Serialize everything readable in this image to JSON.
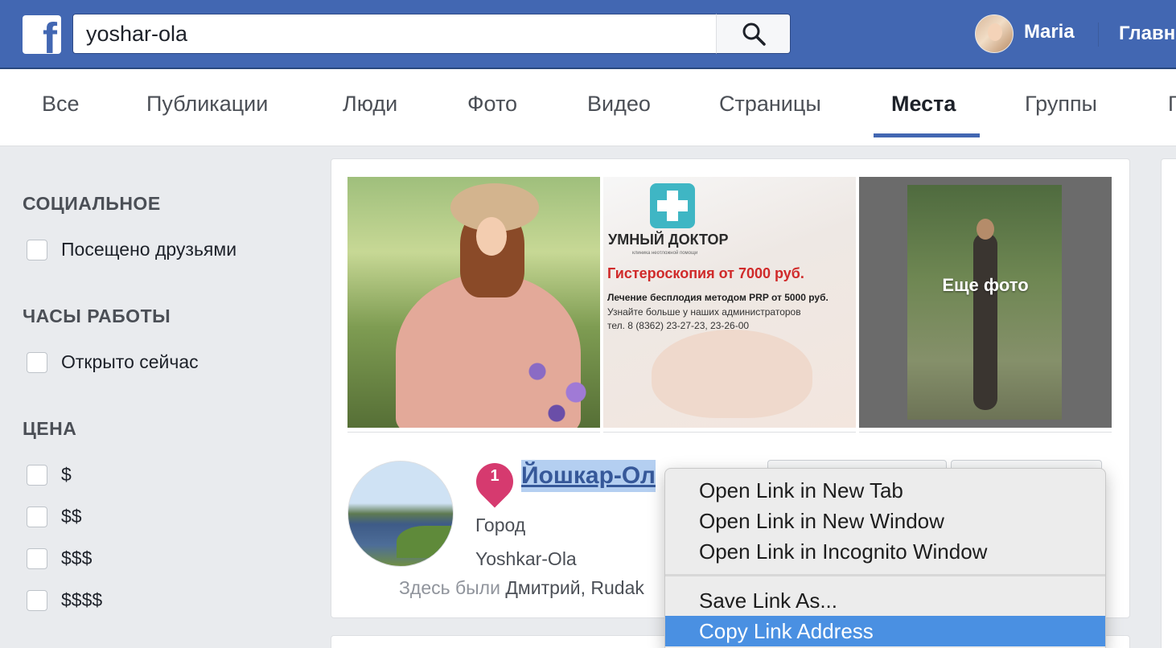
{
  "topbar": {
    "search_value": "yoshar-ola",
    "user_name": "Maria",
    "home_label": "Главн"
  },
  "tabs": [
    {
      "label": "Все",
      "active": false
    },
    {
      "label": "Публикации",
      "active": false
    },
    {
      "label": "Люди",
      "active": false
    },
    {
      "label": "Фото",
      "active": false
    },
    {
      "label": "Видео",
      "active": false
    },
    {
      "label": "Страницы",
      "active": false
    },
    {
      "label": "Места",
      "active": true
    },
    {
      "label": "Группы",
      "active": false
    },
    {
      "label": "Г",
      "active": false
    }
  ],
  "filters": {
    "social": {
      "heading": "СОЦИАЛЬНОЕ",
      "options": [
        {
          "label": "Посещено друзьями",
          "checked": false
        }
      ]
    },
    "hours": {
      "heading": "ЧАСЫ РАБОТЫ",
      "options": [
        {
          "label": "Открыто сейчас",
          "checked": false
        }
      ]
    },
    "price": {
      "heading": "ЦЕНА",
      "options": [
        {
          "label": "$",
          "checked": false
        },
        {
          "label": "$$",
          "checked": false
        },
        {
          "label": "$$$",
          "checked": false
        },
        {
          "label": "$$$$",
          "checked": false
        }
      ]
    }
  },
  "result": {
    "ad": {
      "brand": "УМНЫЙ ДОКТОР",
      "tagline": "клиника неотложной помощи",
      "headline": "Гистероскопия от 7000 руб.",
      "line1": "Лечение бесплодия методом PRP от 5000 руб.",
      "line2": "Узнайте больше у наших администраторов",
      "line3": "тел. 8 (8362) 23-27-23, 23-26-00"
    },
    "more_photos_label": "Еще фото",
    "pin_number": "1",
    "title": "Йошкар-Ол",
    "category": "Город",
    "city": "Yoshkar-Ola",
    "visited_prefix": "Здесь были",
    "visited_names": "Дмитрий, Rudak"
  },
  "context_menu": {
    "items": [
      {
        "label": "Open Link in New Tab",
        "selected": false
      },
      {
        "label": "Open Link in New Window",
        "selected": false
      },
      {
        "label": "Open Link in Incognito Window",
        "selected": false
      },
      {
        "label": "Save Link As...",
        "selected": false
      },
      {
        "label": "Copy Link Address",
        "selected": true
      }
    ]
  },
  "colors": {
    "brand_blue": "#4267b2",
    "link_blue": "#365899",
    "pin_pink": "#d63a6f",
    "menu_highlight": "#4a90e2"
  },
  "icons": [
    "facebook-logo-icon",
    "search-icon",
    "map-pin-icon"
  ]
}
